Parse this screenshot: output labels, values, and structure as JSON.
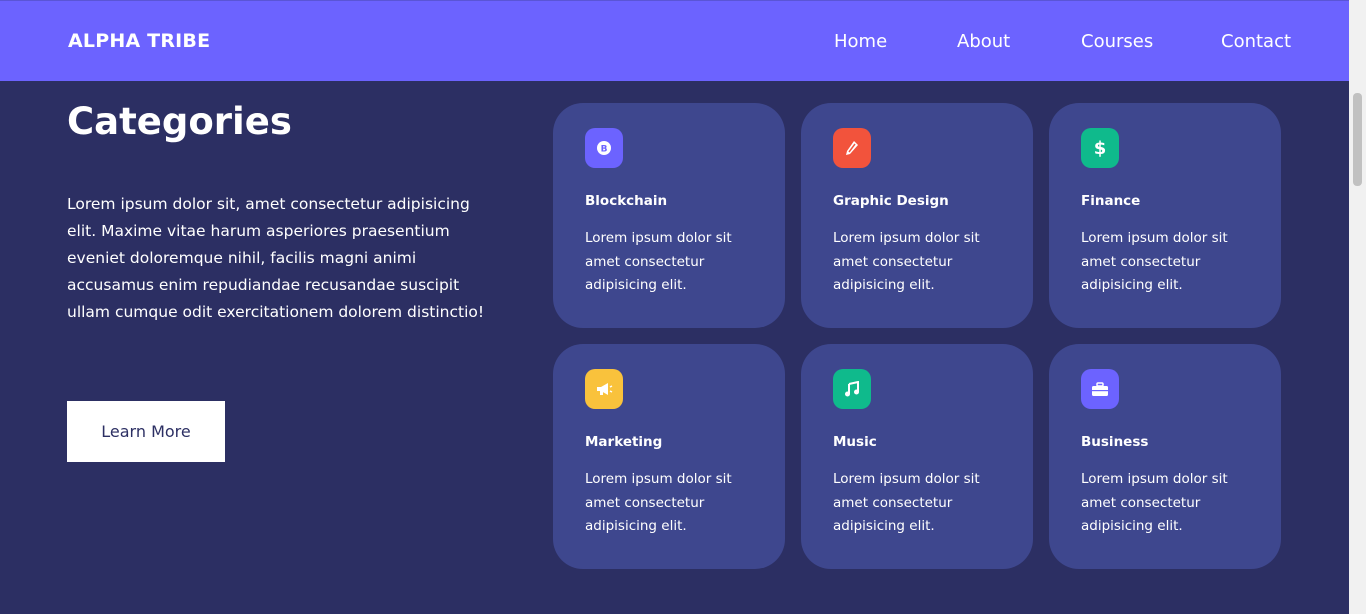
{
  "navbar": {
    "brand": "ALPHA TRIBE",
    "links": [
      {
        "label": "Home"
      },
      {
        "label": "About"
      },
      {
        "label": "Courses"
      },
      {
        "label": "Contact"
      }
    ],
    "background_color": "#6c63ff"
  },
  "hero": {
    "title": "Categories",
    "description": "Lorem ipsum dolor sit, amet consectetur adipisicing elit. Maxime vitae harum asperiores praesentium eveniet doloremque nihil, facilis magni animi accusamus enim repudiandae recusandae suscipit ullam cumque odit exercitationem dolorem distinctio!",
    "button_label": "Learn More"
  },
  "categories": [
    {
      "title": "Blockchain",
      "description": "Lorem ipsum dolor sit amet consectetur adipisicing elit.",
      "icon": "bitcoin-icon",
      "icon_glyph": "₿",
      "icon_color": "#6c63ff"
    },
    {
      "title": "Graphic Design",
      "description": "Lorem ipsum dolor sit amet consectetur adipisicing elit.",
      "icon": "pen-icon",
      "icon_glyph": "✎",
      "icon_color": "#f2533c"
    },
    {
      "title": "Finance",
      "description": "Lorem ipsum dolor sit amet consectetur adipisicing elit.",
      "icon": "dollar-icon",
      "icon_glyph": "$",
      "icon_color": "#0fba8c"
    },
    {
      "title": "Marketing",
      "description": "Lorem ipsum dolor sit amet consectetur adipisicing elit.",
      "icon": "megaphone-icon",
      "icon_glyph": "📣",
      "icon_color": "#f9c23c"
    },
    {
      "title": "Music",
      "description": "Lorem ipsum dolor sit amet consectetur adipisicing elit.",
      "icon": "music-icon",
      "icon_glyph": "♫",
      "icon_color": "#0fba8c"
    },
    {
      "title": "Business",
      "description": "Lorem ipsum dolor sit amet consectetur adipisicing elit.",
      "icon": "briefcase-icon",
      "icon_glyph": "💼",
      "icon_color": "#6c63ff"
    }
  ],
  "colors": {
    "page_background": "#2c2f63",
    "card_background": "#3e478e"
  }
}
